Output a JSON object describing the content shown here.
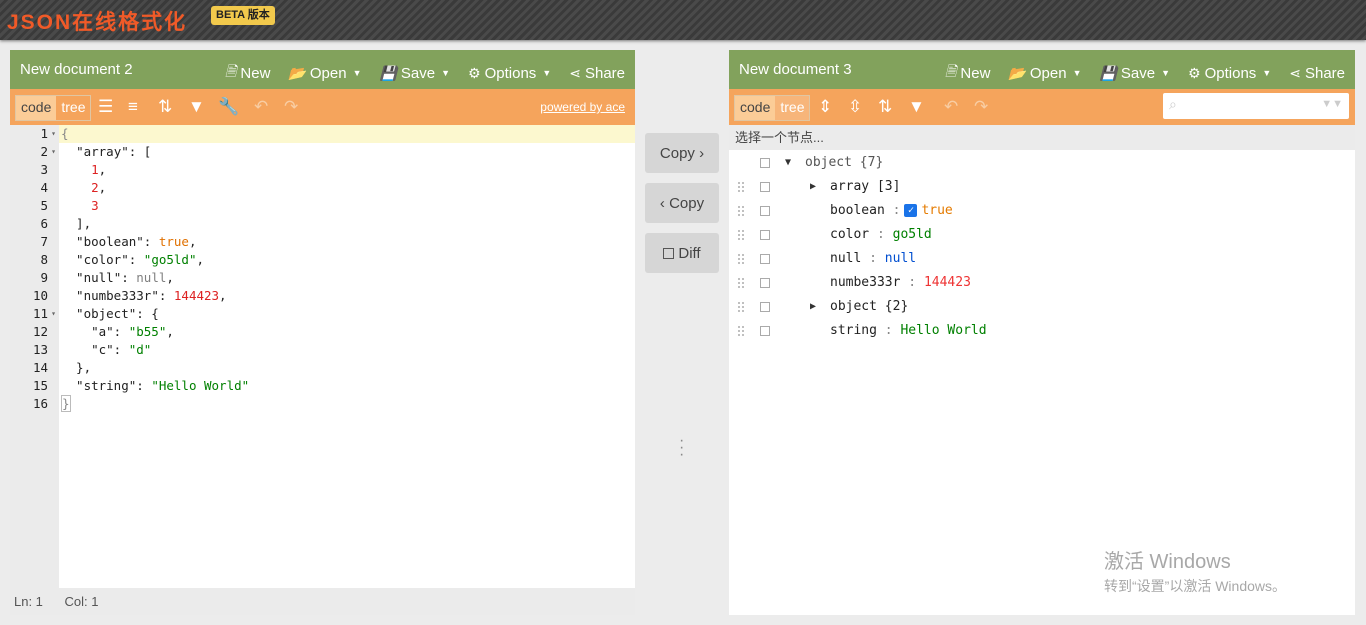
{
  "header": {
    "logo": "JSON在线格式化",
    "badge": "BETA 版本"
  },
  "left": {
    "title": "New document 2",
    "menu": {
      "new": "New",
      "open": "Open",
      "save": "Save",
      "options": "Options",
      "share": "Share"
    },
    "toolbar": {
      "code": "code",
      "tree": "tree",
      "powered": "powered by ace"
    },
    "lines": [
      "1",
      "2",
      "3",
      "4",
      "5",
      "6",
      "7",
      "8",
      "9",
      "10",
      "11",
      "12",
      "13",
      "14",
      "15",
      "16"
    ],
    "status": {
      "ln": "Ln: 1",
      "col": "Col: 1"
    }
  },
  "middle": {
    "copy_right": "Copy ›",
    "copy_left": "‹ Copy",
    "diff": "Diff"
  },
  "right": {
    "title": "New document 3",
    "menu": {
      "new": "New",
      "open": "Open",
      "save": "Save",
      "options": "Options",
      "share": "Share"
    },
    "toolbar": {
      "code": "code",
      "tree": "tree",
      "search_placeholder": ""
    },
    "navbar": "选择一个节点...",
    "tree": {
      "root": "object {7}",
      "array": "array [3]",
      "boolean_key": "boolean",
      "boolean_val": "true",
      "color_key": "color",
      "color_val": "go5ld",
      "null_key": "null",
      "null_val": "null",
      "num_key": "numbe333r",
      "num_val": "144423",
      "object": "object {2}",
      "string_key": "string",
      "string_val": "Hello World"
    }
  },
  "watermark": {
    "line1": "激活 Windows",
    "line2": "转到“设置”以激活 Windows。"
  },
  "colors": {
    "menu": "#82a25c",
    "toolbar": "#f5a45c",
    "logo": "#f05a28"
  }
}
